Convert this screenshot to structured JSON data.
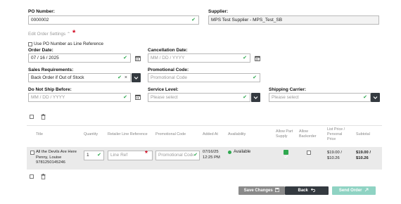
{
  "header": {
    "po_label": "PO Number:",
    "po_value": "0000002",
    "supplier_label": "Supplier:",
    "supplier_value": "MPS Test Supplier - MPS_Test_SB"
  },
  "settings": {
    "toggle_label": "Edit Order Settings",
    "required_star": "*",
    "use_po_label": "Use PO Number as Line Reference",
    "order_date_label": "Order Date:",
    "order_date_value": "07 / 16 / 2025",
    "cancel_date_label": "Cancellation Date:",
    "cancel_date_placeholder": "MM / DD / YYYY",
    "sales_req_label": "Sales Requirements:",
    "sales_req_value": "Back Order if Out of Stock",
    "promo_label": "Promotional Code:",
    "promo_placeholder": "Promotional Code",
    "dns_label": "Do Not Ship Before:",
    "dns_placeholder": "MM / DD / YYYY",
    "service_label": "Service Level:",
    "service_placeholder": "Please select",
    "carrier_label": "Shipping Carrier:",
    "carrier_placeholder": "Please select"
  },
  "table": {
    "columns": {
      "title": "Title",
      "quantity": "Quantity",
      "retailer_ref": "Retailer Line Reference",
      "promo": "Promotional Code",
      "added": "Added At",
      "availability": "Availability",
      "allow_part": "Allow Part Supply",
      "allow_backorder": "Allow Backorder",
      "list_price": "List Price / Personal Price",
      "subtotal": "Subtotal"
    },
    "row": {
      "title": "All the Devils Are Here",
      "author": "Penny, Louise",
      "isbn": "9781250145246",
      "quantity": "1",
      "line_ref_placeholder": "Line Ref",
      "promo_placeholder": "Promotional Code",
      "added_date": "07/16/25",
      "added_time": "12:25 PM",
      "availability": "Available",
      "list_price": "$19.00 /",
      "personal_price": "$10.26",
      "subtotal_list": "$19.00 /",
      "subtotal_personal": "$10.26"
    }
  },
  "buttons": {
    "save": "Save Changes",
    "back": "Back",
    "send": "Send Order"
  },
  "colors": {
    "dark": "#343a40",
    "save_bg": "#8a8a8a",
    "send_bg": "#8fd3c3",
    "success": "#2fa84f",
    "required": "#d0021b"
  }
}
